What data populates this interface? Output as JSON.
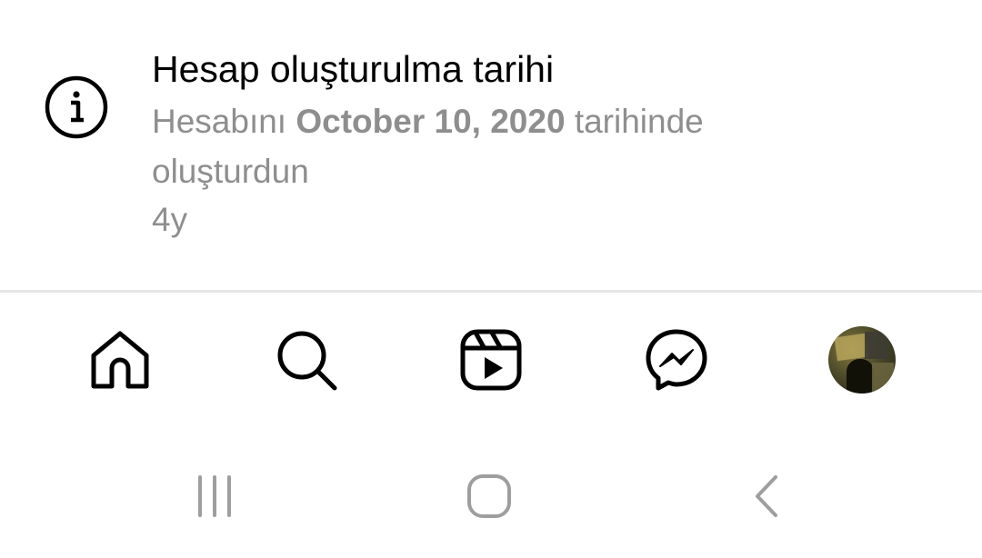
{
  "account_info": {
    "icon": "info-icon",
    "title": "Hesap oluşturulma tarihi",
    "description_prefix": "Hesabını",
    "description_date": "October 10, 2020",
    "description_suffix": "tarihinde oluşturdun",
    "time_ago": "4y"
  },
  "tab_bar": {
    "tabs": [
      {
        "id": "home",
        "icon": "home-icon"
      },
      {
        "id": "search",
        "icon": "search-icon"
      },
      {
        "id": "reels",
        "icon": "reels-icon"
      },
      {
        "id": "messenger",
        "icon": "messenger-icon"
      },
      {
        "id": "profile",
        "icon": "avatar"
      }
    ]
  },
  "system_nav": {
    "buttons": [
      {
        "id": "recents",
        "icon": "recents-icon"
      },
      {
        "id": "home",
        "icon": "home-circle-icon"
      },
      {
        "id": "back",
        "icon": "back-chevron-icon"
      }
    ]
  },
  "colors": {
    "primary_text": "#000000",
    "secondary_text": "#8e8e8e",
    "divider": "#e6e6e6",
    "system_icon": "#9e9e9e"
  }
}
